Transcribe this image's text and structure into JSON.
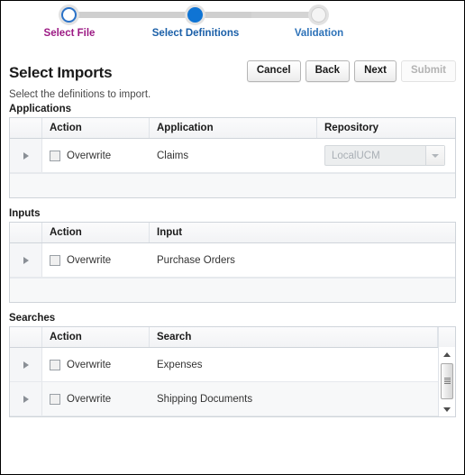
{
  "train": {
    "steps": [
      {
        "label": "Select File",
        "state": "visited"
      },
      {
        "label": "Select Definitions",
        "state": "current"
      },
      {
        "label": "Validation",
        "state": "future"
      }
    ]
  },
  "header": {
    "title": "Select Imports",
    "subtitle": "Select the definitions to import.",
    "buttons": [
      {
        "label": "Cancel",
        "disabled": false
      },
      {
        "label": "Back",
        "disabled": false
      },
      {
        "label": "Next",
        "disabled": false
      },
      {
        "label": "Submit",
        "disabled": true
      }
    ]
  },
  "sections": [
    {
      "title": "Applications",
      "columns": [
        "",
        "Action",
        "Application",
        "Repository"
      ],
      "rows": [
        {
          "action_label": "Overwrite",
          "checked": false,
          "name": "Claims",
          "repository": "LocalUCM"
        }
      ],
      "has_scrollbar": false,
      "has_filler": true
    },
    {
      "title": "Inputs",
      "columns": [
        "",
        "Action",
        "Input"
      ],
      "rows": [
        {
          "action_label": "Overwrite",
          "checked": false,
          "name": "Purchase Orders"
        }
      ],
      "has_scrollbar": false,
      "has_filler": true
    },
    {
      "title": "Searches",
      "columns": [
        "",
        "Action",
        "Search"
      ],
      "rows": [
        {
          "action_label": "Overwrite",
          "checked": false,
          "name": "Expenses"
        },
        {
          "action_label": "Overwrite",
          "checked": false,
          "name": "Shipping Documents"
        }
      ],
      "has_scrollbar": true,
      "has_filler": false
    }
  ],
  "colors": {
    "current_step": "#0f74d4",
    "visited_step_label": "#9c1a84",
    "current_step_label": "#1a5fa8",
    "future_step_label": "#2d72b8"
  }
}
